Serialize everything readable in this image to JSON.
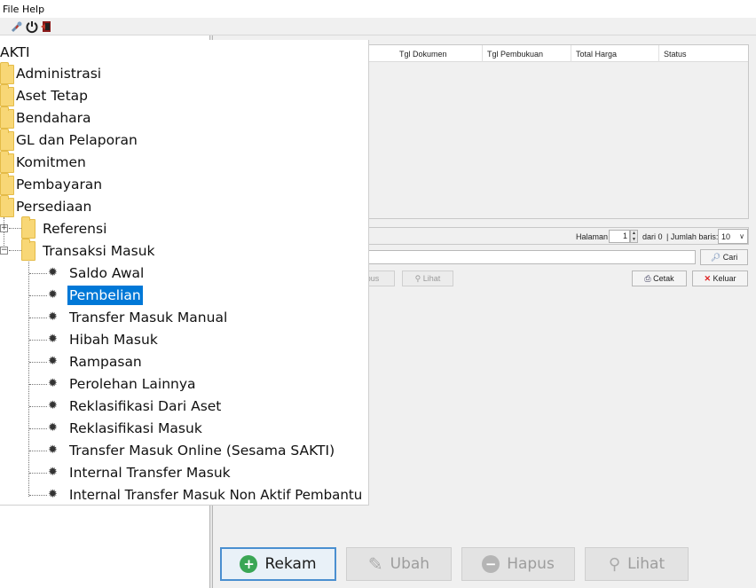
{
  "menu": {
    "file": "File",
    "help": "Help"
  },
  "toolbar": {
    "icons": [
      "tools-icon",
      "power-icon",
      "exit-icon"
    ]
  },
  "table": {
    "columns": [
      "Tgl Dokumen",
      "Tgl Pembukuan",
      "Total Harga",
      "Status"
    ]
  },
  "pager": {
    "page_label": "Halaman",
    "page_value": "1",
    "of_label": "dari 0",
    "rows_label": "| Jumlah baris:",
    "rows_value": "10"
  },
  "search": {
    "button": "Cari"
  },
  "actions": {
    "hapus_partial": "apus",
    "lihat": "Lihat",
    "cetak": "Cetak",
    "keluar": "Keluar"
  },
  "bottom_buttons": {
    "rekam": "Rekam",
    "ubah": "Ubah",
    "hapus": "Hapus",
    "lihat": "Lihat"
  },
  "tree": {
    "root": "AKTI",
    "modules": [
      "Administrasi",
      "Aset Tetap",
      "Bendahara",
      "GL dan Pelaporan",
      "Komitmen",
      "Pembayaran",
      "Persediaan"
    ],
    "persediaan_children": [
      "Referensi",
      "Transaksi Masuk"
    ],
    "transaksi_masuk_items": [
      "Saldo Awal",
      "Pembelian",
      "Transfer Masuk Manual",
      "Hibah Masuk",
      "Rampasan",
      "Perolehan Lainnya",
      "Reklasifikasi Dari Aset",
      "Reklasifikasi Masuk",
      "Transfer Masuk Online (Sesama SAKTI)",
      "Internal Transfer Masuk",
      "Internal Transfer Masuk Non Aktif Pembantu"
    ],
    "selected": "Pembelian"
  },
  "colors": {
    "selection": "#0078d7",
    "folder": "#f8d776",
    "accent_border": "#4a8fd0"
  }
}
